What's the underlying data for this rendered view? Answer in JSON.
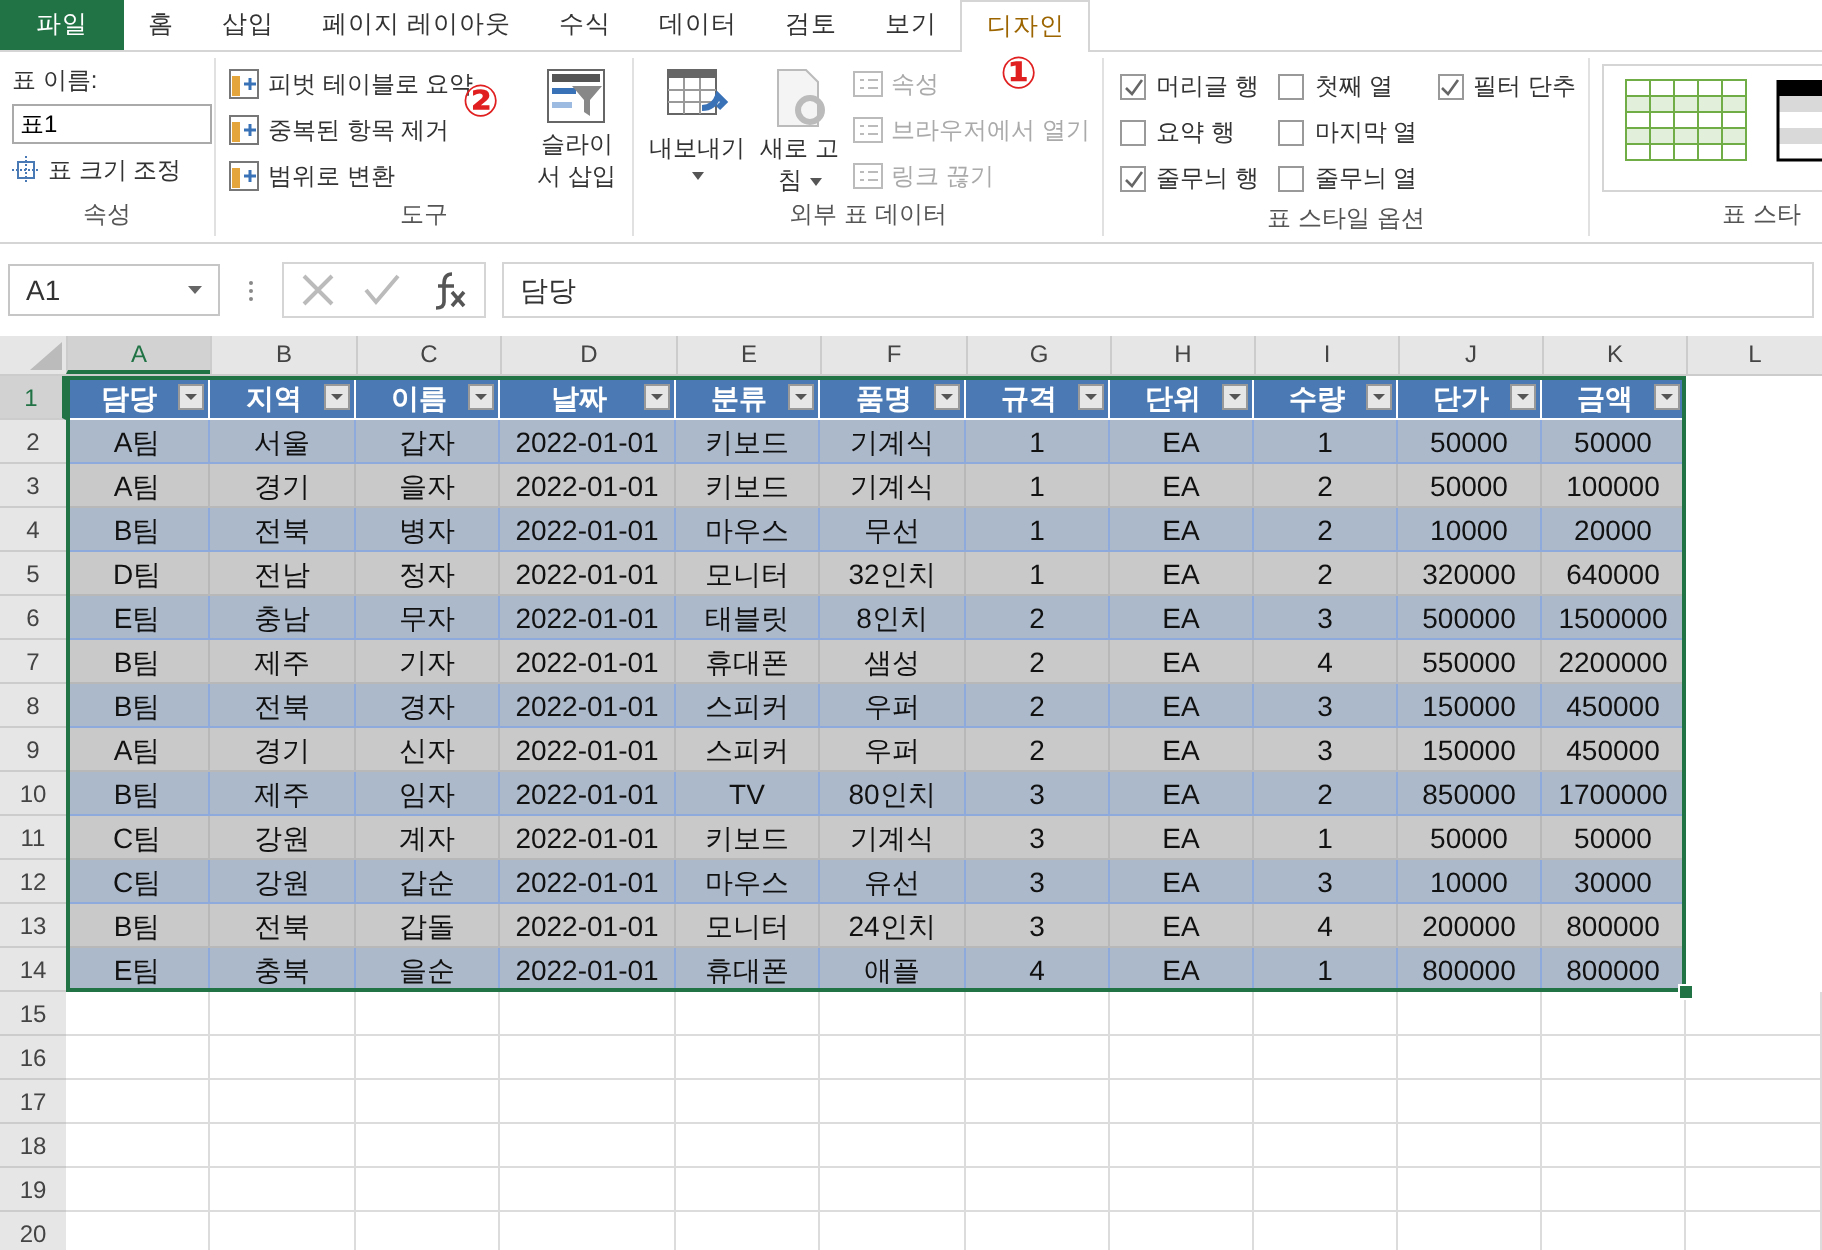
{
  "tabs": [
    {
      "label": "파일",
      "kind": "file",
      "selected": false
    },
    {
      "label": "홈",
      "kind": "tab",
      "selected": false
    },
    {
      "label": "삽입",
      "kind": "tab",
      "selected": false
    },
    {
      "label": "페이지 레이아웃",
      "kind": "tab",
      "selected": false
    },
    {
      "label": "수식",
      "kind": "tab",
      "selected": false
    },
    {
      "label": "데이터",
      "kind": "tab",
      "selected": false
    },
    {
      "label": "검토",
      "kind": "tab",
      "selected": false
    },
    {
      "label": "보기",
      "kind": "tab",
      "selected": false
    },
    {
      "label": "디자인",
      "kind": "tab",
      "selected": true
    }
  ],
  "callouts": [
    "①",
    "②"
  ],
  "ribbon": {
    "properties": {
      "name_label": "표 이름:",
      "name_value": "표1",
      "resize": "표 크기 조정",
      "group": "속성"
    },
    "tools": {
      "items": [
        {
          "label": "피벗 테이블로 요약"
        },
        {
          "label": "중복된 항목 제거"
        },
        {
          "label": "범위로 변환"
        }
      ],
      "slicer": "슬라이서 삽입",
      "group": "도구"
    },
    "external": {
      "export": "내보내기",
      "refresh": "새로 고침",
      "items": [
        {
          "label": "속성",
          "disabled": true
        },
        {
          "label": "브라우저에서 열기",
          "disabled": true
        },
        {
          "label": "링크 끊기",
          "disabled": true
        }
      ],
      "group": "외부 표 데이터"
    },
    "style_options": {
      "items": [
        {
          "label": "머리글 행",
          "checked": true
        },
        {
          "label": "요약 행",
          "checked": false
        },
        {
          "label": "줄무늬 행",
          "checked": true
        },
        {
          "label": "첫째 열",
          "checked": false
        },
        {
          "label": "마지막 열",
          "checked": false
        },
        {
          "label": "줄무늬 열",
          "checked": false
        },
        {
          "label": "필터 단추",
          "checked": true
        }
      ],
      "group": "표 스타일 옵션"
    },
    "styles": {
      "group": "표 스타"
    }
  },
  "formula_bar": {
    "name_box": "A1",
    "value": "담당"
  },
  "sheet": {
    "columns": [
      "A",
      "B",
      "C",
      "D",
      "E",
      "F",
      "G",
      "H",
      "I",
      "J",
      "K",
      "L"
    ],
    "row_numbers": [
      "1",
      "2",
      "3",
      "4",
      "5",
      "6",
      "7",
      "8",
      "9",
      "10",
      "11",
      "12",
      "13",
      "14",
      "15",
      "16",
      "17",
      "18",
      "19",
      "20"
    ],
    "table": {
      "header": [
        "담당",
        "지역",
        "이름",
        "날짜",
        "분류",
        "품명",
        "규격",
        "단위",
        "수량",
        "단가",
        "금액"
      ],
      "rows": [
        [
          "A팀",
          "서울",
          "갑자",
          "2022-01-01",
          "키보드",
          "기계식",
          "1",
          "EA",
          "1",
          "50000",
          "50000"
        ],
        [
          "A팀",
          "경기",
          "을자",
          "2022-01-01",
          "키보드",
          "기계식",
          "1",
          "EA",
          "2",
          "50000",
          "100000"
        ],
        [
          "B팀",
          "전북",
          "병자",
          "2022-01-01",
          "마우스",
          "무선",
          "1",
          "EA",
          "2",
          "10000",
          "20000"
        ],
        [
          "D팀",
          "전남",
          "정자",
          "2022-01-01",
          "모니터",
          "32인치",
          "1",
          "EA",
          "2",
          "320000",
          "640000"
        ],
        [
          "E팀",
          "충남",
          "무자",
          "2022-01-01",
          "태블릿",
          "8인치",
          "2",
          "EA",
          "3",
          "500000",
          "1500000"
        ],
        [
          "B팀",
          "제주",
          "기자",
          "2022-01-01",
          "휴대폰",
          "샘성",
          "2",
          "EA",
          "4",
          "550000",
          "2200000"
        ],
        [
          "B팀",
          "전북",
          "경자",
          "2022-01-01",
          "스피커",
          "우퍼",
          "2",
          "EA",
          "3",
          "150000",
          "450000"
        ],
        [
          "A팀",
          "경기",
          "신자",
          "2022-01-01",
          "스피커",
          "우퍼",
          "2",
          "EA",
          "3",
          "150000",
          "450000"
        ],
        [
          "B팀",
          "제주",
          "임자",
          "2022-01-01",
          "TV",
          "80인치",
          "3",
          "EA",
          "2",
          "850000",
          "1700000"
        ],
        [
          "C팀",
          "강원",
          "계자",
          "2022-01-01",
          "키보드",
          "기계식",
          "3",
          "EA",
          "1",
          "50000",
          "50000"
        ],
        [
          "C팀",
          "강원",
          "갑순",
          "2022-01-01",
          "마우스",
          "유선",
          "3",
          "EA",
          "3",
          "10000",
          "30000"
        ],
        [
          "B팀",
          "전북",
          "갑돌",
          "2022-01-01",
          "모니터",
          "24인치",
          "3",
          "EA",
          "4",
          "200000",
          "800000"
        ],
        [
          "E팀",
          "충북",
          "을순",
          "2022-01-01",
          "휴대폰",
          "애플",
          "4",
          "EA",
          "1",
          "800000",
          "800000"
        ]
      ]
    }
  }
}
